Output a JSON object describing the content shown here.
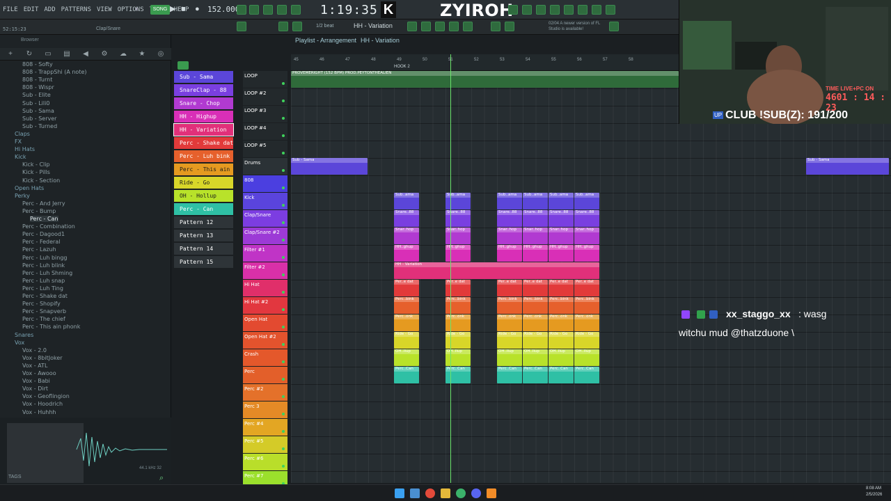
{
  "menu": [
    "FILE",
    "EDIT",
    "ADD",
    "PATTERNS",
    "VIEW",
    "OPTIONS",
    "TOOLS",
    "HELP"
  ],
  "toolbar": {
    "tempo": "152.000",
    "time": "1:19:35",
    "streamer": "ZYIROH",
    "k_badge": "K",
    "snap_label": "1/2 beat",
    "pattern_name": "HH - Variation",
    "hint": "02/04  A newer version of FL Studio is available!",
    "memory": "52:15:23",
    "channel_hint": "Clap/Snare",
    "playlist_title": "Playlist - Arrangement",
    "playlist_pattern": "HH - Variation"
  },
  "browser": {
    "title": "Browser",
    "tabs": [
      "plus-icon",
      "refresh-icon",
      "folder-icon",
      "file-icon",
      "speaker-icon",
      "plugin-icon",
      "cloud-icon",
      "star-icon",
      "globe-icon"
    ],
    "items": [
      {
        "label": "808 - Softy",
        "indent": 2,
        "folder": false
      },
      {
        "label": "808 - TrappShi (A note)",
        "indent": 2,
        "folder": false
      },
      {
        "label": "808 - Turnt",
        "indent": 2,
        "folder": false
      },
      {
        "label": "808 - Wispr",
        "indent": 2,
        "folder": false
      },
      {
        "label": "Sub - Elite",
        "indent": 2,
        "folder": false
      },
      {
        "label": "Sub - Lili0",
        "indent": 2,
        "folder": false
      },
      {
        "label": "Sub - Sama",
        "indent": 2,
        "folder": false
      },
      {
        "label": "Sub - Server",
        "indent": 2,
        "folder": false
      },
      {
        "label": "Sub - Turned",
        "indent": 2,
        "folder": false
      },
      {
        "label": "Claps",
        "indent": 1,
        "folder": true
      },
      {
        "label": "FX",
        "indent": 1,
        "folder": true
      },
      {
        "label": "Hi Hats",
        "indent": 1,
        "folder": true
      },
      {
        "label": "Kick",
        "indent": 1,
        "folder": true
      },
      {
        "label": "Kick - Clip",
        "indent": 2,
        "folder": false
      },
      {
        "label": "Kick - Pills",
        "indent": 2,
        "folder": false
      },
      {
        "label": "Kick - Section",
        "indent": 2,
        "folder": false
      },
      {
        "label": "Open Hats",
        "indent": 1,
        "folder": true
      },
      {
        "label": "Perky",
        "indent": 1,
        "folder": true
      },
      {
        "label": "Perc - And Jerry",
        "indent": 2,
        "folder": false
      },
      {
        "label": "Perc - Bump",
        "indent": 2,
        "folder": false
      },
      {
        "label": "Perc - Can",
        "indent": 3,
        "folder": false,
        "selected": true
      },
      {
        "label": "Perc - Combination",
        "indent": 2,
        "folder": false
      },
      {
        "label": "Perc - Dagood1",
        "indent": 2,
        "folder": false
      },
      {
        "label": "Perc - Federal",
        "indent": 2,
        "folder": false
      },
      {
        "label": "Perc - Lazuh",
        "indent": 2,
        "folder": false
      },
      {
        "label": "Perc - Luh bingg",
        "indent": 2,
        "folder": false
      },
      {
        "label": "Perc - Luh blink",
        "indent": 2,
        "folder": false
      },
      {
        "label": "Perc - Luh Shming",
        "indent": 2,
        "folder": false
      },
      {
        "label": "Perc - Luh snap",
        "indent": 2,
        "folder": false
      },
      {
        "label": "Perc - Luh Ting",
        "indent": 2,
        "folder": false
      },
      {
        "label": "Perc - Shake dat",
        "indent": 2,
        "folder": false
      },
      {
        "label": "Perc - Shopify",
        "indent": 2,
        "folder": false
      },
      {
        "label": "Perc - Snapverb",
        "indent": 2,
        "folder": false
      },
      {
        "label": "Perc - The chief",
        "indent": 2,
        "folder": false
      },
      {
        "label": "Perc - This ain phonk",
        "indent": 2,
        "folder": false
      },
      {
        "label": "Snares",
        "indent": 1,
        "folder": true
      },
      {
        "label": "Vox",
        "indent": 1,
        "folder": true
      },
      {
        "label": "Vox - 2.0",
        "indent": 2,
        "folder": false
      },
      {
        "label": "Vox - 8bitJoker",
        "indent": 2,
        "folder": false
      },
      {
        "label": "Vox - ATL",
        "indent": 2,
        "folder": false
      },
      {
        "label": "Vox - Awooo",
        "indent": 2,
        "folder": false
      },
      {
        "label": "Vox - Babi",
        "indent": 2,
        "folder": false
      },
      {
        "label": "Vox - Dirt",
        "indent": 2,
        "folder": false
      },
      {
        "label": "Vox - Geoflingion",
        "indent": 2,
        "folder": false
      },
      {
        "label": "Vox - Hoodrich",
        "indent": 2,
        "folder": false
      },
      {
        "label": "Vox - Huhhh",
        "indent": 2,
        "folder": false
      }
    ],
    "sample_info": "44.1 kHz 32",
    "tags_label": "TAGS"
  },
  "patterns": [
    {
      "label": "Sub - Sama",
      "color": "#5b46d9"
    },
    {
      "label": "SnareClap - 88",
      "color": "#7a3fe0"
    },
    {
      "label": "Snare - Chop",
      "color": "#b13ad1"
    },
    {
      "label": "HH - Highup",
      "color": "#d92fb7"
    },
    {
      "label": "HH - Variation",
      "color": "#e1307a",
      "selected": true
    },
    {
      "label": "Perc - Shake dat",
      "color": "#e23a3a"
    },
    {
      "label": "Perc - Luh bink",
      "color": "#e6602c"
    },
    {
      "label": "Perc - This ain phonk",
      "color": "#e59a20"
    },
    {
      "label": "Ride - Go",
      "color": "#d8d629"
    },
    {
      "label": "OH - Hollup",
      "color": "#b8e22a"
    },
    {
      "label": "Perc - Can",
      "color": "#2fc0a5"
    },
    {
      "label": "Pattern 12",
      "color": "#2e3438"
    },
    {
      "label": "Pattern 13",
      "color": "#2e3438"
    },
    {
      "label": "Pattern 14",
      "color": "#2e3438"
    },
    {
      "label": "Pattern 15",
      "color": "#2e3438"
    }
  ],
  "ruler": {
    "marker": "HOOK 2",
    "bars": [
      "45",
      "46",
      "47",
      "48",
      "49",
      "50",
      "51",
      "52",
      "53",
      "54",
      "55",
      "56",
      "57",
      "58"
    ]
  },
  "audio_clip": "PROVEMERIGHT (152 BPM) PROD.PEYTONTHEALIEN",
  "tracks": [
    {
      "label": "LOOP",
      "color": "#23292c"
    },
    {
      "label": "LOOP #2",
      "color": "#23292c"
    },
    {
      "label": "LOOP #3",
      "color": "#23292c"
    },
    {
      "label": "LOOP #4",
      "color": "#23292c"
    },
    {
      "label": "LOOP #5",
      "color": "#23292c"
    },
    {
      "label": "Drums",
      "color": "#2b3236"
    },
    {
      "label": "808",
      "color": "#4b3fe0"
    },
    {
      "label": "Kick",
      "color": "#5a44dd"
    },
    {
      "label": "Clap/Snare",
      "color": "#7c3de1"
    },
    {
      "label": "Clap/Snare #2",
      "color": "#9c3ad6"
    },
    {
      "label": "Filter #1",
      "color": "#c034c6"
    },
    {
      "label": "Filter #2",
      "color": "#d930a8"
    },
    {
      "label": "Hi Hat",
      "color": "#e02f6a"
    },
    {
      "label": "Hi Hat #2",
      "color": "#e2373f"
    },
    {
      "label": "Open Hat",
      "color": "#e34a30"
    },
    {
      "label": "Open Hat #2",
      "color": "#e3532d"
    },
    {
      "label": "Crash",
      "color": "#e4582b"
    },
    {
      "label": "Perc",
      "color": "#e35f2a"
    },
    {
      "label": "Perc #2",
      "color": "#e4712a"
    },
    {
      "label": "Perc 3",
      "color": "#e48a26"
    },
    {
      "label": "Perc #4",
      "color": "#e3a623"
    },
    {
      "label": "Perc #5",
      "color": "#d4cb28"
    },
    {
      "label": "Perc #6",
      "color": "#b9de2a"
    },
    {
      "label": "Perc #7",
      "color": "#9be02c"
    }
  ],
  "clips": [
    {
      "row": 5,
      "start": 0,
      "len": 6,
      "label": "Sub - Sama",
      "color": "#5b46d9"
    },
    {
      "row": 5,
      "start": 40,
      "len": 6.5,
      "label": "Sub - Sama",
      "color": "#5b46d9"
    },
    {
      "row": 7,
      "start": 8,
      "len": 2,
      "label": "Sub..ama",
      "color": "#5b46d9"
    },
    {
      "row": 7,
      "start": 12,
      "len": 2,
      "label": "Sub..ama",
      "color": "#5b46d9"
    },
    {
      "row": 7,
      "start": 16,
      "len": 2,
      "label": "Sub..ama",
      "color": "#5b46d9"
    },
    {
      "row": 7,
      "start": 18,
      "len": 2,
      "label": "Sub..ama",
      "color": "#5b46d9"
    },
    {
      "row": 7,
      "start": 20,
      "len": 2,
      "label": "Sub..ama",
      "color": "#5b46d9"
    },
    {
      "row": 7,
      "start": 22,
      "len": 2,
      "label": "Sub..ama",
      "color": "#5b46d9"
    },
    {
      "row": 8,
      "start": 8,
      "len": 2,
      "label": "Snare..88",
      "color": "#7a3fe0"
    },
    {
      "row": 8,
      "start": 12,
      "len": 2,
      "label": "Snare..88",
      "color": "#7a3fe0"
    },
    {
      "row": 8,
      "start": 16,
      "len": 2,
      "label": "Snare..88",
      "color": "#7a3fe0"
    },
    {
      "row": 8,
      "start": 18,
      "len": 2,
      "label": "Snare..88",
      "color": "#7a3fe0"
    },
    {
      "row": 8,
      "start": 20,
      "len": 2,
      "label": "Snare..88",
      "color": "#7a3fe0"
    },
    {
      "row": 8,
      "start": 22,
      "len": 2,
      "label": "Snare..88",
      "color": "#7a3fe0"
    },
    {
      "row": 9,
      "start": 8,
      "len": 2,
      "label": "Snar..hop",
      "color": "#b13ad1"
    },
    {
      "row": 9,
      "start": 12,
      "len": 2,
      "label": "Snar..hop",
      "color": "#b13ad1"
    },
    {
      "row": 9,
      "start": 16,
      "len": 2,
      "label": "Snar..hop",
      "color": "#b13ad1"
    },
    {
      "row": 9,
      "start": 18,
      "len": 2,
      "label": "Snar..hop",
      "color": "#b13ad1"
    },
    {
      "row": 9,
      "start": 20,
      "len": 2,
      "label": "Snar..hop",
      "color": "#b13ad1"
    },
    {
      "row": 9,
      "start": 22,
      "len": 2,
      "label": "Snar..hop",
      "color": "#b13ad1"
    },
    {
      "row": 10,
      "start": 8,
      "len": 2,
      "label": "HH..ghup",
      "color": "#d92fb7"
    },
    {
      "row": 10,
      "start": 12,
      "len": 2,
      "label": "HH..ghup",
      "color": "#d92fb7"
    },
    {
      "row": 10,
      "start": 16,
      "len": 2,
      "label": "HH..ghup",
      "color": "#d92fb7"
    },
    {
      "row": 10,
      "start": 18,
      "len": 2,
      "label": "HH..ghup",
      "color": "#d92fb7"
    },
    {
      "row": 10,
      "start": 20,
      "len": 2,
      "label": "HH..ghup",
      "color": "#d92fb7"
    },
    {
      "row": 10,
      "start": 22,
      "len": 2,
      "label": "HH..ghup",
      "color": "#d92fb7"
    },
    {
      "row": 11,
      "start": 8,
      "len": 16,
      "label": "HH - Variation",
      "color": "#e1307a"
    },
    {
      "row": 12,
      "start": 8,
      "len": 2,
      "label": "Per..e dat",
      "color": "#e23a3a"
    },
    {
      "row": 12,
      "start": 12,
      "len": 2,
      "label": "Per..e dat",
      "color": "#e23a3a"
    },
    {
      "row": 12,
      "start": 16,
      "len": 2,
      "label": "Per..e dat",
      "color": "#e23a3a"
    },
    {
      "row": 12,
      "start": 18,
      "len": 2,
      "label": "Per..e dat",
      "color": "#e23a3a"
    },
    {
      "row": 12,
      "start": 20,
      "len": 2,
      "label": "Per..e dat",
      "color": "#e23a3a"
    },
    {
      "row": 12,
      "start": 22,
      "len": 2,
      "label": "Per..e dat",
      "color": "#e23a3a"
    },
    {
      "row": 13,
      "start": 8,
      "len": 2,
      "label": "Perc..bink",
      "color": "#e6602c"
    },
    {
      "row": 13,
      "start": 12,
      "len": 2,
      "label": "Perc..bink",
      "color": "#e6602c"
    },
    {
      "row": 13,
      "start": 16,
      "len": 2,
      "label": "Perc..bink",
      "color": "#e6602c"
    },
    {
      "row": 13,
      "start": 18,
      "len": 2,
      "label": "Perc..bink",
      "color": "#e6602c"
    },
    {
      "row": 13,
      "start": 20,
      "len": 2,
      "label": "Perc..bink",
      "color": "#e6602c"
    },
    {
      "row": 13,
      "start": 22,
      "len": 2,
      "label": "Perc..bink",
      "color": "#e6602c"
    },
    {
      "row": 14,
      "start": 8,
      "len": 2,
      "label": "Perc..onk",
      "color": "#e59a20"
    },
    {
      "row": 14,
      "start": 12,
      "len": 2,
      "label": "Perc..onk",
      "color": "#e59a20"
    },
    {
      "row": 14,
      "start": 16,
      "len": 2,
      "label": "Perc..onk",
      "color": "#e59a20"
    },
    {
      "row": 14,
      "start": 18,
      "len": 2,
      "label": "Perc..onk",
      "color": "#e59a20"
    },
    {
      "row": 14,
      "start": 20,
      "len": 2,
      "label": "Perc..onk",
      "color": "#e59a20"
    },
    {
      "row": 14,
      "start": 22,
      "len": 2,
      "label": "Perc..onk",
      "color": "#e59a20"
    },
    {
      "row": 15,
      "start": 8,
      "len": 2,
      "label": "Ride - Go",
      "color": "#d8d629"
    },
    {
      "row": 15,
      "start": 12,
      "len": 2,
      "label": "Ride - Go",
      "color": "#d8d629"
    },
    {
      "row": 15,
      "start": 16,
      "len": 2,
      "label": "Ride - Go",
      "color": "#d8d629"
    },
    {
      "row": 15,
      "start": 18,
      "len": 2,
      "label": "Ride - Go",
      "color": "#d8d629"
    },
    {
      "row": 15,
      "start": 20,
      "len": 2,
      "label": "Ride - Go",
      "color": "#d8d629"
    },
    {
      "row": 15,
      "start": 22,
      "len": 2,
      "label": "Ride - Go",
      "color": "#d8d629"
    },
    {
      "row": 16,
      "start": 8,
      "len": 2,
      "label": "OH..llup",
      "color": "#b8e22a"
    },
    {
      "row": 16,
      "start": 12,
      "len": 2,
      "label": "OH..llup",
      "color": "#b8e22a"
    },
    {
      "row": 16,
      "start": 16,
      "len": 2,
      "label": "OH..llup",
      "color": "#b8e22a"
    },
    {
      "row": 16,
      "start": 18,
      "len": 2,
      "label": "OH..llup",
      "color": "#b8e22a"
    },
    {
      "row": 16,
      "start": 20,
      "len": 2,
      "label": "OH..llup",
      "color": "#b8e22a"
    },
    {
      "row": 16,
      "start": 22,
      "len": 2,
      "label": "OH..llup",
      "color": "#b8e22a"
    },
    {
      "row": 17,
      "start": 8,
      "len": 2,
      "label": "Perc..Can",
      "color": "#2fc0a5"
    },
    {
      "row": 17,
      "start": 12,
      "len": 2,
      "label": "Perc..Can",
      "color": "#2fc0a5"
    },
    {
      "row": 17,
      "start": 16,
      "len": 2,
      "label": "Perc..Can",
      "color": "#2fc0a5"
    },
    {
      "row": 17,
      "start": 18,
      "len": 2,
      "label": "Perc..Can",
      "color": "#2fc0a5"
    },
    {
      "row": 17,
      "start": 20,
      "len": 2,
      "label": "Perc..Can",
      "color": "#2fc0a5"
    },
    {
      "row": 17,
      "start": 22,
      "len": 2,
      "label": "Perc..Can",
      "color": "#2fc0a5"
    }
  ],
  "webcam": {
    "live_label": "TIME LIVE+PC ON",
    "live_timer": "4601 : 14 : 23",
    "sub_goal": "CLUB !SUB(Z): 191/200",
    "up_badge": "UP"
  },
  "chat": {
    "username": "xx_staggo_xx",
    "message_head": ": wasg",
    "message_tail": "witchu mud @thatzduone \\"
  },
  "taskbar": {
    "clock_time": "8:08 AM",
    "clock_date": "2/5/2026"
  }
}
